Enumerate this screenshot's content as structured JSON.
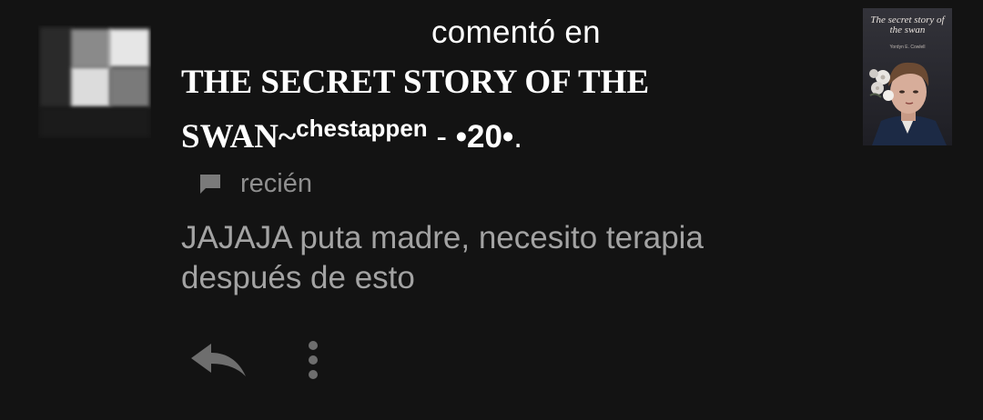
{
  "notification": {
    "header": "comentó en",
    "story": {
      "title_main": "THE SECRET STORY OF THE SWAN~",
      "title_sup": "chestappen",
      "title_suffix_pre": " - ",
      "title_suffix_bold": "•20•",
      "title_suffix_post": "."
    },
    "meta": {
      "icon": "comment-icon",
      "time": "recién"
    },
    "comment_text": "JAJAJA puta madre, necesito terapia después de esto",
    "cover": {
      "title": "The secret story of the swan",
      "author": "Yordyn E. Cowlell"
    },
    "actions": {
      "reply_icon": "reply-icon",
      "more_icon": "more-vertical-icon"
    }
  },
  "colors": {
    "background": "#131313",
    "primary_text": "#ffffff",
    "secondary_text": "#8f8f8f",
    "comment_text": "#a3a3a3",
    "icon": "#7a7a7a"
  }
}
